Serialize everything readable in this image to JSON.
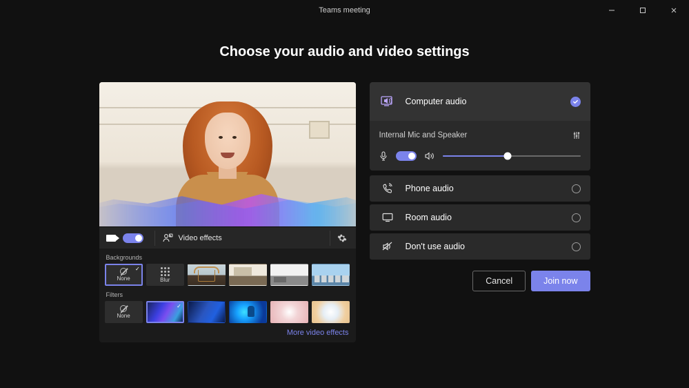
{
  "window": {
    "title": "Teams meeting"
  },
  "heading": "Choose your audio and video settings",
  "video_toolbar": {
    "effects_label": "Video effects"
  },
  "effects": {
    "backgrounds_label": "Backgrounds",
    "filters_label": "Filters",
    "none_label": "None",
    "blur_label": "Blur",
    "more_link": "More video effects"
  },
  "audio": {
    "options": {
      "computer": "Computer audio",
      "phone": "Phone audio",
      "room": "Room audio",
      "none": "Don't use audio"
    },
    "device_label": "Internal Mic and Speaker",
    "volume_percent": 47
  },
  "footer": {
    "cancel": "Cancel",
    "join": "Join now"
  }
}
